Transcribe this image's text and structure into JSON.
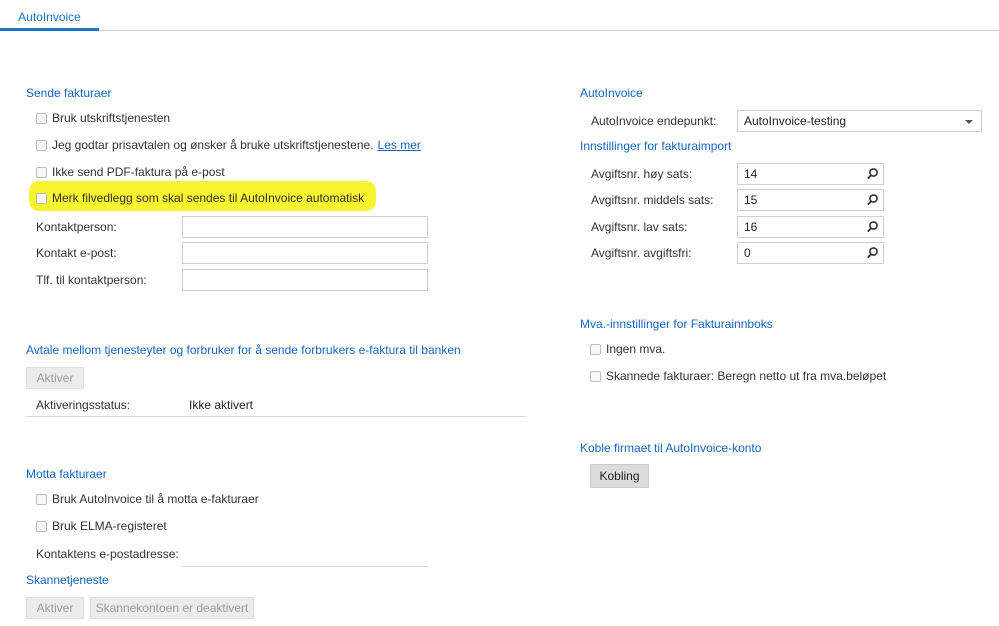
{
  "tabs": [
    {
      "label": "AutoInvoice"
    }
  ],
  "sende": {
    "title": "Sende fakturaer",
    "checkboxes": [
      {
        "label": "Bruk utskriftstjenesten"
      },
      {
        "label": "Jeg godtar prisavtalen og ønsker å bruke utskriftstjenestene.",
        "link": "Les mer"
      },
      {
        "label": "Ikke send PDF-faktura på e-post"
      },
      {
        "label": "Merk filvedlegg som skal sendes til AutoInvoice automatisk"
      }
    ],
    "fields": [
      {
        "label": "Kontaktperson:",
        "value": ""
      },
      {
        "label": "Kontakt e-post:",
        "value": ""
      },
      {
        "label": "Tlf. til kontaktperson:",
        "value": ""
      }
    ],
    "highlight_color": "#f8f32f"
  },
  "avtale": {
    "title": "Avtale mellom tjenesteyter og forbruker for å sende forbrukers e-faktura til banken",
    "activate_label": "Aktiver",
    "status_label": "Aktiveringsstatus:",
    "status_value": "Ikke aktivert"
  },
  "motta": {
    "title": "Motta fakturaer",
    "checkboxes": [
      {
        "label": "Bruk AutoInvoice til å motta e-fakturaer"
      },
      {
        "label": "Bruk ELMA-registeret"
      }
    ],
    "email_label": "Kontaktens e-postadresse:",
    "email_value": ""
  },
  "skanne": {
    "title": "Skannetjeneste",
    "activate_label": "Aktiver",
    "status_label": "Skannekontoen er deaktivert"
  },
  "autoinvoice": {
    "title": "AutoInvoice",
    "endpoint_label": "AutoInvoice endepunkt:",
    "endpoint_value": "AutoInvoice-testing"
  },
  "import": {
    "title": "Innstillinger for fakturaimport",
    "fields": [
      {
        "label": "Avgiftsnr. høy sats:",
        "value": "14"
      },
      {
        "label": "Avgiftsnr. middels sats:",
        "value": "15"
      },
      {
        "label": "Avgiftsnr. lav sats:",
        "value": "16"
      },
      {
        "label": "Avgiftsnr. avgiftsfri:",
        "value": "0"
      }
    ]
  },
  "mva": {
    "title": "Mva.-innstillinger for Fakturainnboks",
    "checkboxes": [
      {
        "label": "Ingen mva."
      },
      {
        "label": "Skannede fakturaer: Beregn netto ut fra mva.beløpet"
      }
    ]
  },
  "koble": {
    "title": "Koble firmaet til AutoInvoice-konto",
    "button_label": "Kobling"
  },
  "colors": {
    "accent": "#1565c0",
    "tab_accent": "#1a73c7"
  }
}
